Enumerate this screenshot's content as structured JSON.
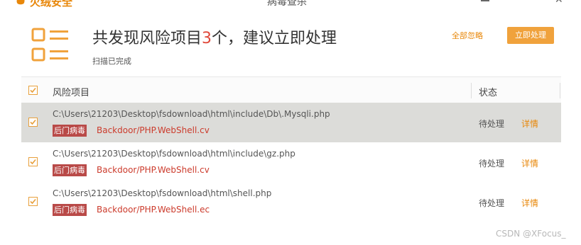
{
  "titlebar": {
    "app_name": "火绒安全",
    "center_text": "病毒查杀",
    "close_glyph": "✕"
  },
  "header": {
    "headline_prefix": "共发现风险项目",
    "headline_count": "3",
    "headline_suffix": "个，建议立即处理",
    "subtext": "扫描已完成",
    "ignore_all_label": "全部忽略",
    "handle_now_label": "立即处理"
  },
  "table": {
    "col_risk": "风险项目",
    "col_status": "状态",
    "rows": [
      {
        "path": "C:\\Users\\21203\\Desktop\\fsdownload\\html\\include\\Db\\.Mysqli.php",
        "tag": "后门病毒",
        "virus": "Backdoor/PHP.WebShell.cv",
        "status": "待处理",
        "detail": "详情"
      },
      {
        "path": "C:\\Users\\21203\\Desktop\\fsdownload\\html\\include\\gz.php",
        "tag": "后门病毒",
        "virus": "Backdoor/PHP.WebShell.cv",
        "status": "待处理",
        "detail": "详情"
      },
      {
        "path": "C:\\Users\\21203\\Desktop\\fsdownload\\html\\shell.php",
        "tag": "后门病毒",
        "virus": "Backdoor/PHP.WebShell.ec",
        "status": "待处理",
        "detail": "详情"
      }
    ]
  },
  "watermark": "CSDN @XFocus_",
  "colors": {
    "accent": "#f0a23c",
    "accent_text": "#e8870a",
    "danger": "#cc3b2c",
    "tag_bg": "#b94a48",
    "highlight_row": "#dcdcd9"
  },
  "icons": {
    "list": "list-icon",
    "checkbox": "checkbox-checked-icon",
    "logo": "flame-logo-icon"
  }
}
